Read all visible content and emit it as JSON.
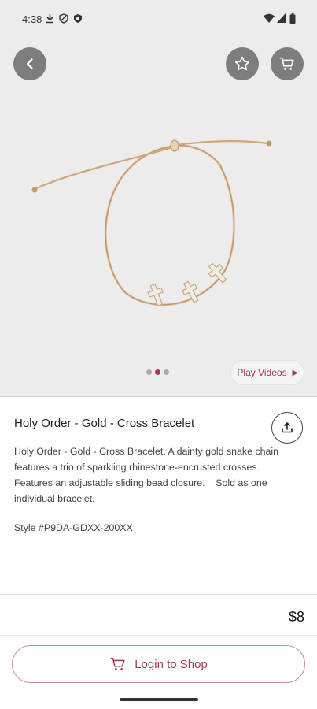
{
  "status": {
    "time": "4:38",
    "left_icons": [
      "download-icon",
      "vpn-shield-icon",
      "security-shield-icon"
    ],
    "right_icons": [
      "wifi-icon",
      "cell-signal-icon",
      "battery-icon"
    ]
  },
  "toolbar": {
    "back_icon": "back-arrow-icon",
    "favorite_icon": "star-icon",
    "cart_icon": "cart-icon"
  },
  "gallery": {
    "image_count": 3,
    "active_index": 1,
    "play_label": "Play Videos"
  },
  "product": {
    "title": "Holy Order - Gold - Cross Bracelet",
    "description": "Holy Order - Gold - Cross Bracelet. A dainty gold snake chain features a trio of sparkling rhinestone-encrusted crosses. Features an adjustable sliding bead closure.    Sold as one individual bracelet.",
    "style": "Style #P9DA-GDXX-200XX",
    "price": "$8"
  },
  "actions": {
    "login_label": "Login to Shop",
    "share_icon": "share-icon"
  },
  "colors": {
    "accent": "#a33a5e",
    "hero_bg": "#ececec",
    "round_button": "#7d7d7d"
  }
}
